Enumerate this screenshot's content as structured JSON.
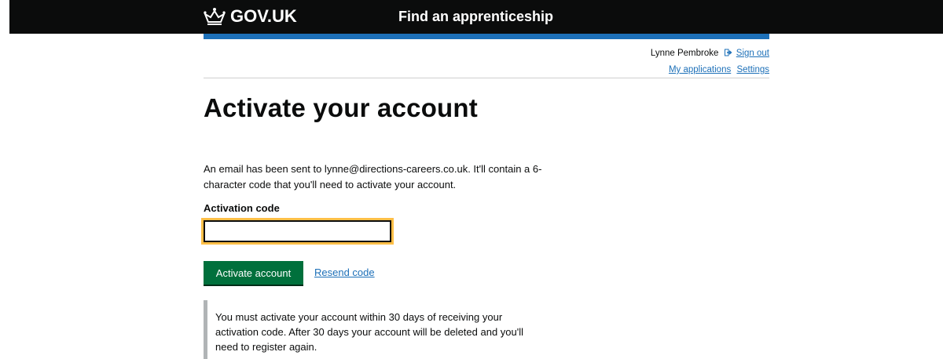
{
  "header": {
    "logo_text": "GOV.UK",
    "service_name": "Find an apprenticeship",
    "colors": {
      "header_background": "#0b0c0c",
      "stripe": "#1d70b8"
    }
  },
  "account": {
    "user_name": "Lynne Pembroke",
    "sign_out_label": "Sign out",
    "my_applications_label": "My applications",
    "settings_label": "Settings",
    "sign_out_icon": "sign-out-icon"
  },
  "page": {
    "title": "Activate your account",
    "intro_text": "An email has been sent to lynne@directions-careers.co.uk. It'll contain a 6-character code that you'll need to activate your account."
  },
  "form": {
    "activation_label": "Activation code",
    "activation_value": "",
    "activate_button_label": "Activate account",
    "resend_link_label": "Resend code",
    "colors": {
      "button": "#00703c",
      "focus": "#ffbf47",
      "link": "#1d70b8"
    }
  },
  "notice": {
    "text": "You must activate your account within 30 days of receiving your activation code. After 30 days your account will be deleted and you'll need to register again."
  }
}
